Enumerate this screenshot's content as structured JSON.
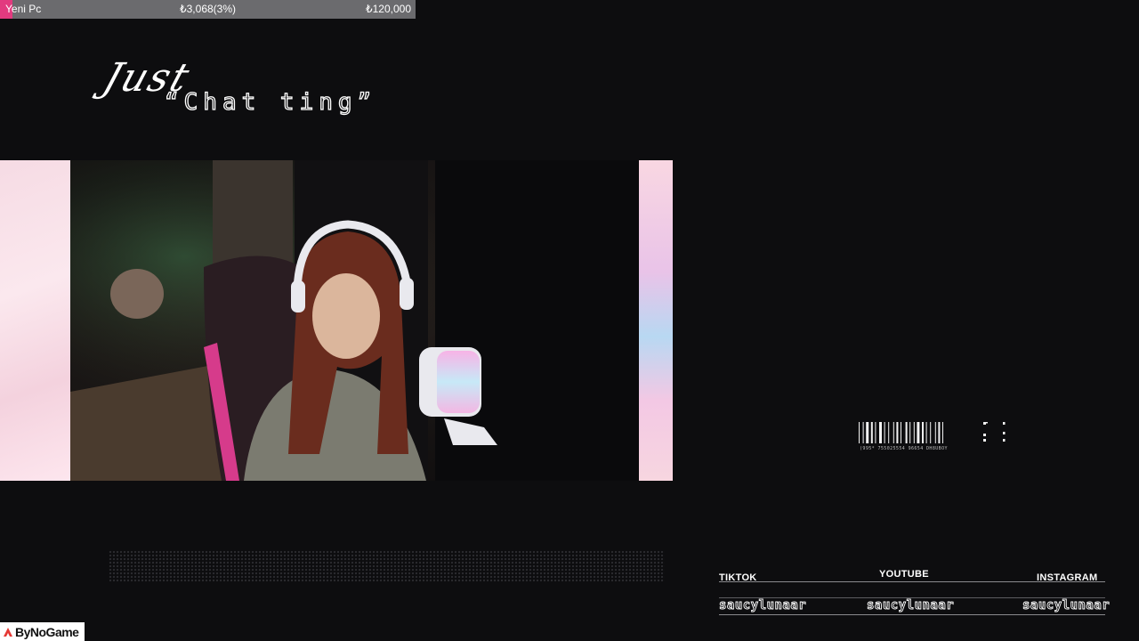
{
  "goal": {
    "label": "Yeni Pc",
    "current": "₺3,068(3%)",
    "target": "₺120,000",
    "progress_fraction": 0.03,
    "bar_color": "#e23a7f"
  },
  "title": {
    "line1": "Just",
    "line2": "“Chat ting”"
  },
  "barcode": {
    "digits": "(995* 755025554 96654 DH8UBOY"
  },
  "socials": [
    {
      "platform": "TIKTOK",
      "handle": "saucylunaar"
    },
    {
      "platform": "YOUTUBE",
      "handle": "saucylunaar"
    },
    {
      "platform": "INSTAGRAM",
      "handle": "saucylunaar"
    }
  ],
  "watermark": {
    "brand": "ByNoGame",
    "icon": "bynogame-logo-icon"
  }
}
